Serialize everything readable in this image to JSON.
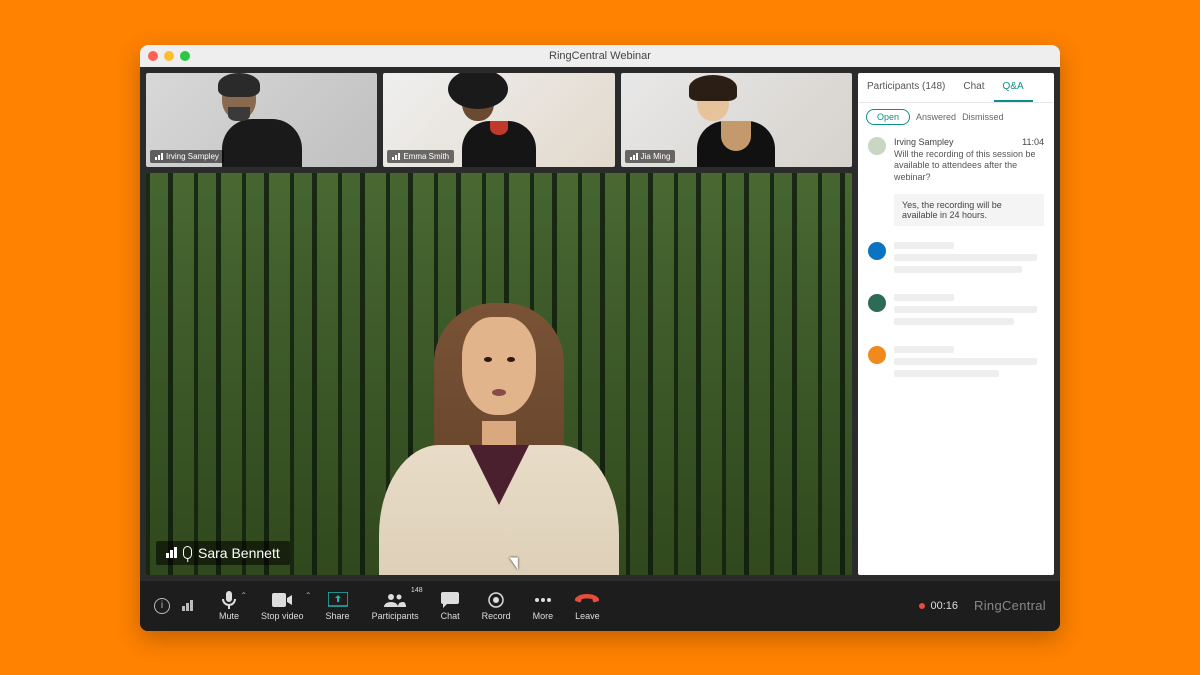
{
  "window": {
    "title": "RingCentral Webinar"
  },
  "thumbnails": [
    {
      "name": "Irving Sampley"
    },
    {
      "name": "Emma Smith"
    },
    {
      "name": "Jia Ming"
    }
  ],
  "main_speaker": {
    "name": "Sara Bennett"
  },
  "side": {
    "tabs": {
      "participants": "Participants (148)",
      "chat": "Chat",
      "qa": "Q&A"
    },
    "filters": {
      "open": "Open",
      "answered": "Answered",
      "dismissed": "Dismissed"
    },
    "question": {
      "author": "Irving Sampley",
      "time": "11:04",
      "text": "Will the recording of this session be available to attendees after the webinar?",
      "answer": "Yes, the recording will be available in 24 hours."
    }
  },
  "toolbar": {
    "mute": "Mute",
    "stop_video": "Stop video",
    "share": "Share",
    "participants": "Participants",
    "participants_count": "148",
    "chat": "Chat",
    "record": "Record",
    "more": "More",
    "leave": "Leave",
    "timer": "00:16",
    "brand": "RingCentral"
  },
  "colors": {
    "accent": "#0a8f8a",
    "leave": "#e74c3c",
    "skeleton_avatars": [
      "#0a74c2",
      "#2e6b54",
      "#f08a1d"
    ]
  }
}
